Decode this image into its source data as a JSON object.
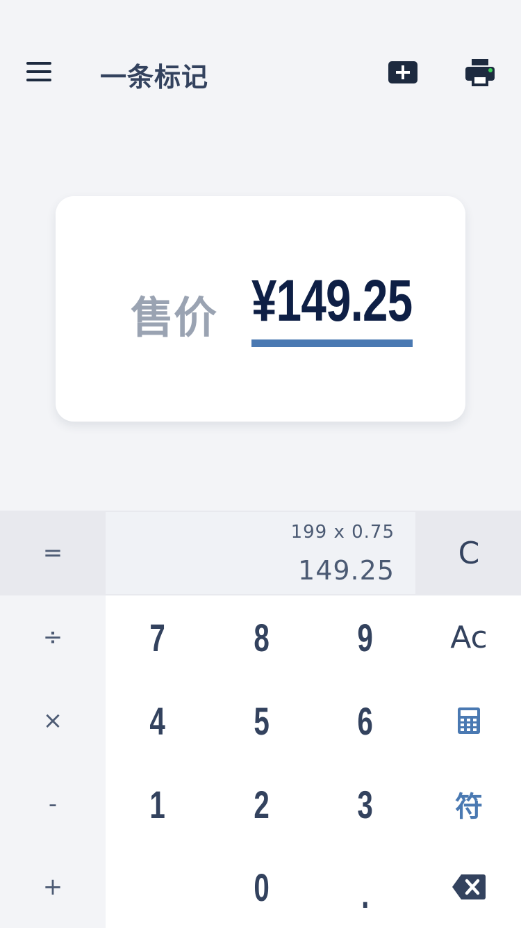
{
  "header": {
    "title": "一条标记"
  },
  "card": {
    "label": "售价",
    "price": "¥149.25"
  },
  "calculator": {
    "expression": "199 x 0.75",
    "result": "149.25",
    "operators": {
      "equals": "=",
      "divide": "÷",
      "multiply": "×",
      "minus": "-",
      "plus": "+"
    },
    "keys": {
      "seven": "7",
      "eight": "8",
      "nine": "9",
      "four": "4",
      "five": "5",
      "six": "6",
      "one": "1",
      "two": "2",
      "three": "3",
      "zero": "0",
      "dot": "."
    },
    "clear": "C",
    "all_clear": "Ac",
    "symbol": "符"
  },
  "colors": {
    "accent": "#4a79b2",
    "dark": "#0e1f45",
    "text": "#33425e",
    "notification_dot": "#3ccf5a"
  }
}
